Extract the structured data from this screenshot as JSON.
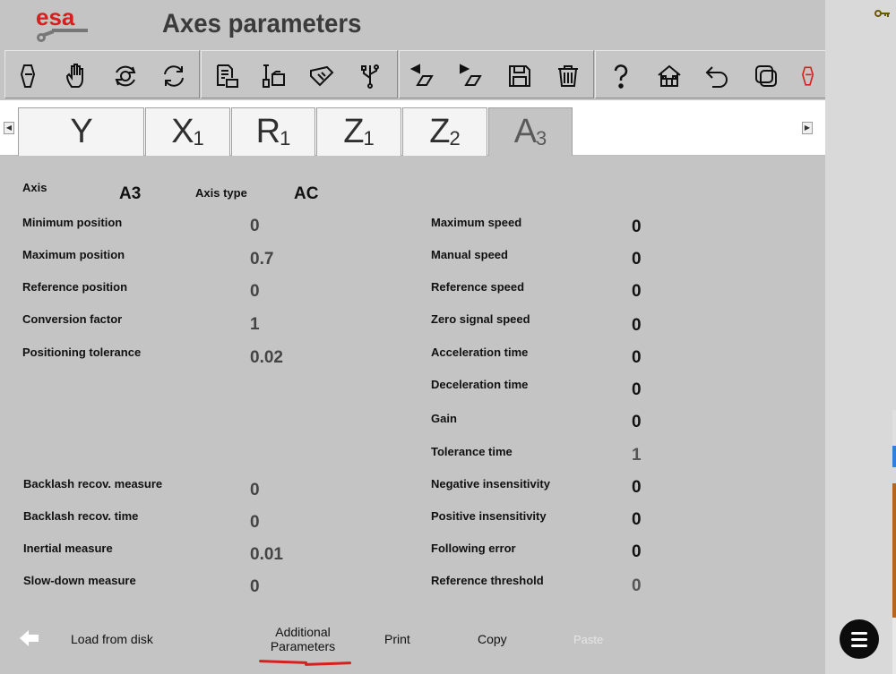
{
  "header": {
    "logo_text": "esa",
    "title": "Axes parameters"
  },
  "toolbar": {
    "icons": [
      "pen-drive-icon",
      "hand-icon",
      "gear-refresh-icon",
      "refresh-icon",
      "document-folder-icon",
      "tools-folder-icon",
      "measure-icon",
      "usb-icon",
      "prev-axis-icon",
      "next-axis-icon",
      "save-icon",
      "trash-icon",
      "help-icon",
      "home-icon",
      "undo-icon",
      "copy-window-icon",
      "pen-drive-red-icon"
    ]
  },
  "tabs": [
    {
      "main": "Y",
      "sub": ""
    },
    {
      "main": "X",
      "sub": "1"
    },
    {
      "main": "R",
      "sub": "1"
    },
    {
      "main": "Z",
      "sub": "1"
    },
    {
      "main": "Z",
      "sub": "2"
    },
    {
      "main": "A",
      "sub": "3",
      "active": true
    }
  ],
  "axis": {
    "axis_label": "Axis",
    "axis_value": "A3",
    "type_label": "Axis type",
    "type_value": "AC"
  },
  "left_params": {
    "min_pos": {
      "label": "Minimum position",
      "value": "0"
    },
    "max_pos": {
      "label": "Maximum position",
      "value": "0.7"
    },
    "ref_pos": {
      "label": "Reference position",
      "value": "0"
    },
    "conv": {
      "label": "Conversion factor",
      "value": "1"
    },
    "pos_tol": {
      "label": "Positioning tolerance",
      "value": "0.02"
    },
    "backlash_meas": {
      "label": "Backlash recov. measure",
      "value": "0"
    },
    "backlash_time": {
      "label": "Backlash recov. time",
      "value": "0"
    },
    "inertial": {
      "label": "Inertial measure",
      "value": "0.01"
    },
    "slowdown": {
      "label": "Slow-down measure",
      "value": "0"
    }
  },
  "right_params": {
    "max_speed": {
      "label": "Maximum speed",
      "value": "0"
    },
    "manual_speed": {
      "label": "Manual speed",
      "value": "0"
    },
    "ref_speed": {
      "label": "Reference speed",
      "value": "0"
    },
    "zero_speed": {
      "label": "Zero signal speed",
      "value": "0"
    },
    "accel": {
      "label": "Acceleration time",
      "value": "0"
    },
    "decel": {
      "label": "Deceleration time",
      "value": "0"
    },
    "gain": {
      "label": "Gain",
      "value": "0"
    },
    "tol_time": {
      "label": "Tolerance time",
      "value": "1"
    },
    "neg_ins": {
      "label": "Negative insensitivity",
      "value": "0"
    },
    "pos_ins": {
      "label": "Positive insensitivity",
      "value": "0"
    },
    "follow_err": {
      "label": "Following error",
      "value": "0"
    },
    "ref_thresh": {
      "label": "Reference threshold",
      "value": "0"
    }
  },
  "footer": {
    "load": "Load from disk",
    "additional_1": "Additional",
    "additional_2": "Parameters",
    "print": "Print",
    "copy": "Copy",
    "paste": "Paste"
  },
  "colors": {
    "brand_red": "#d62020",
    "background": "#c4c4c4"
  }
}
